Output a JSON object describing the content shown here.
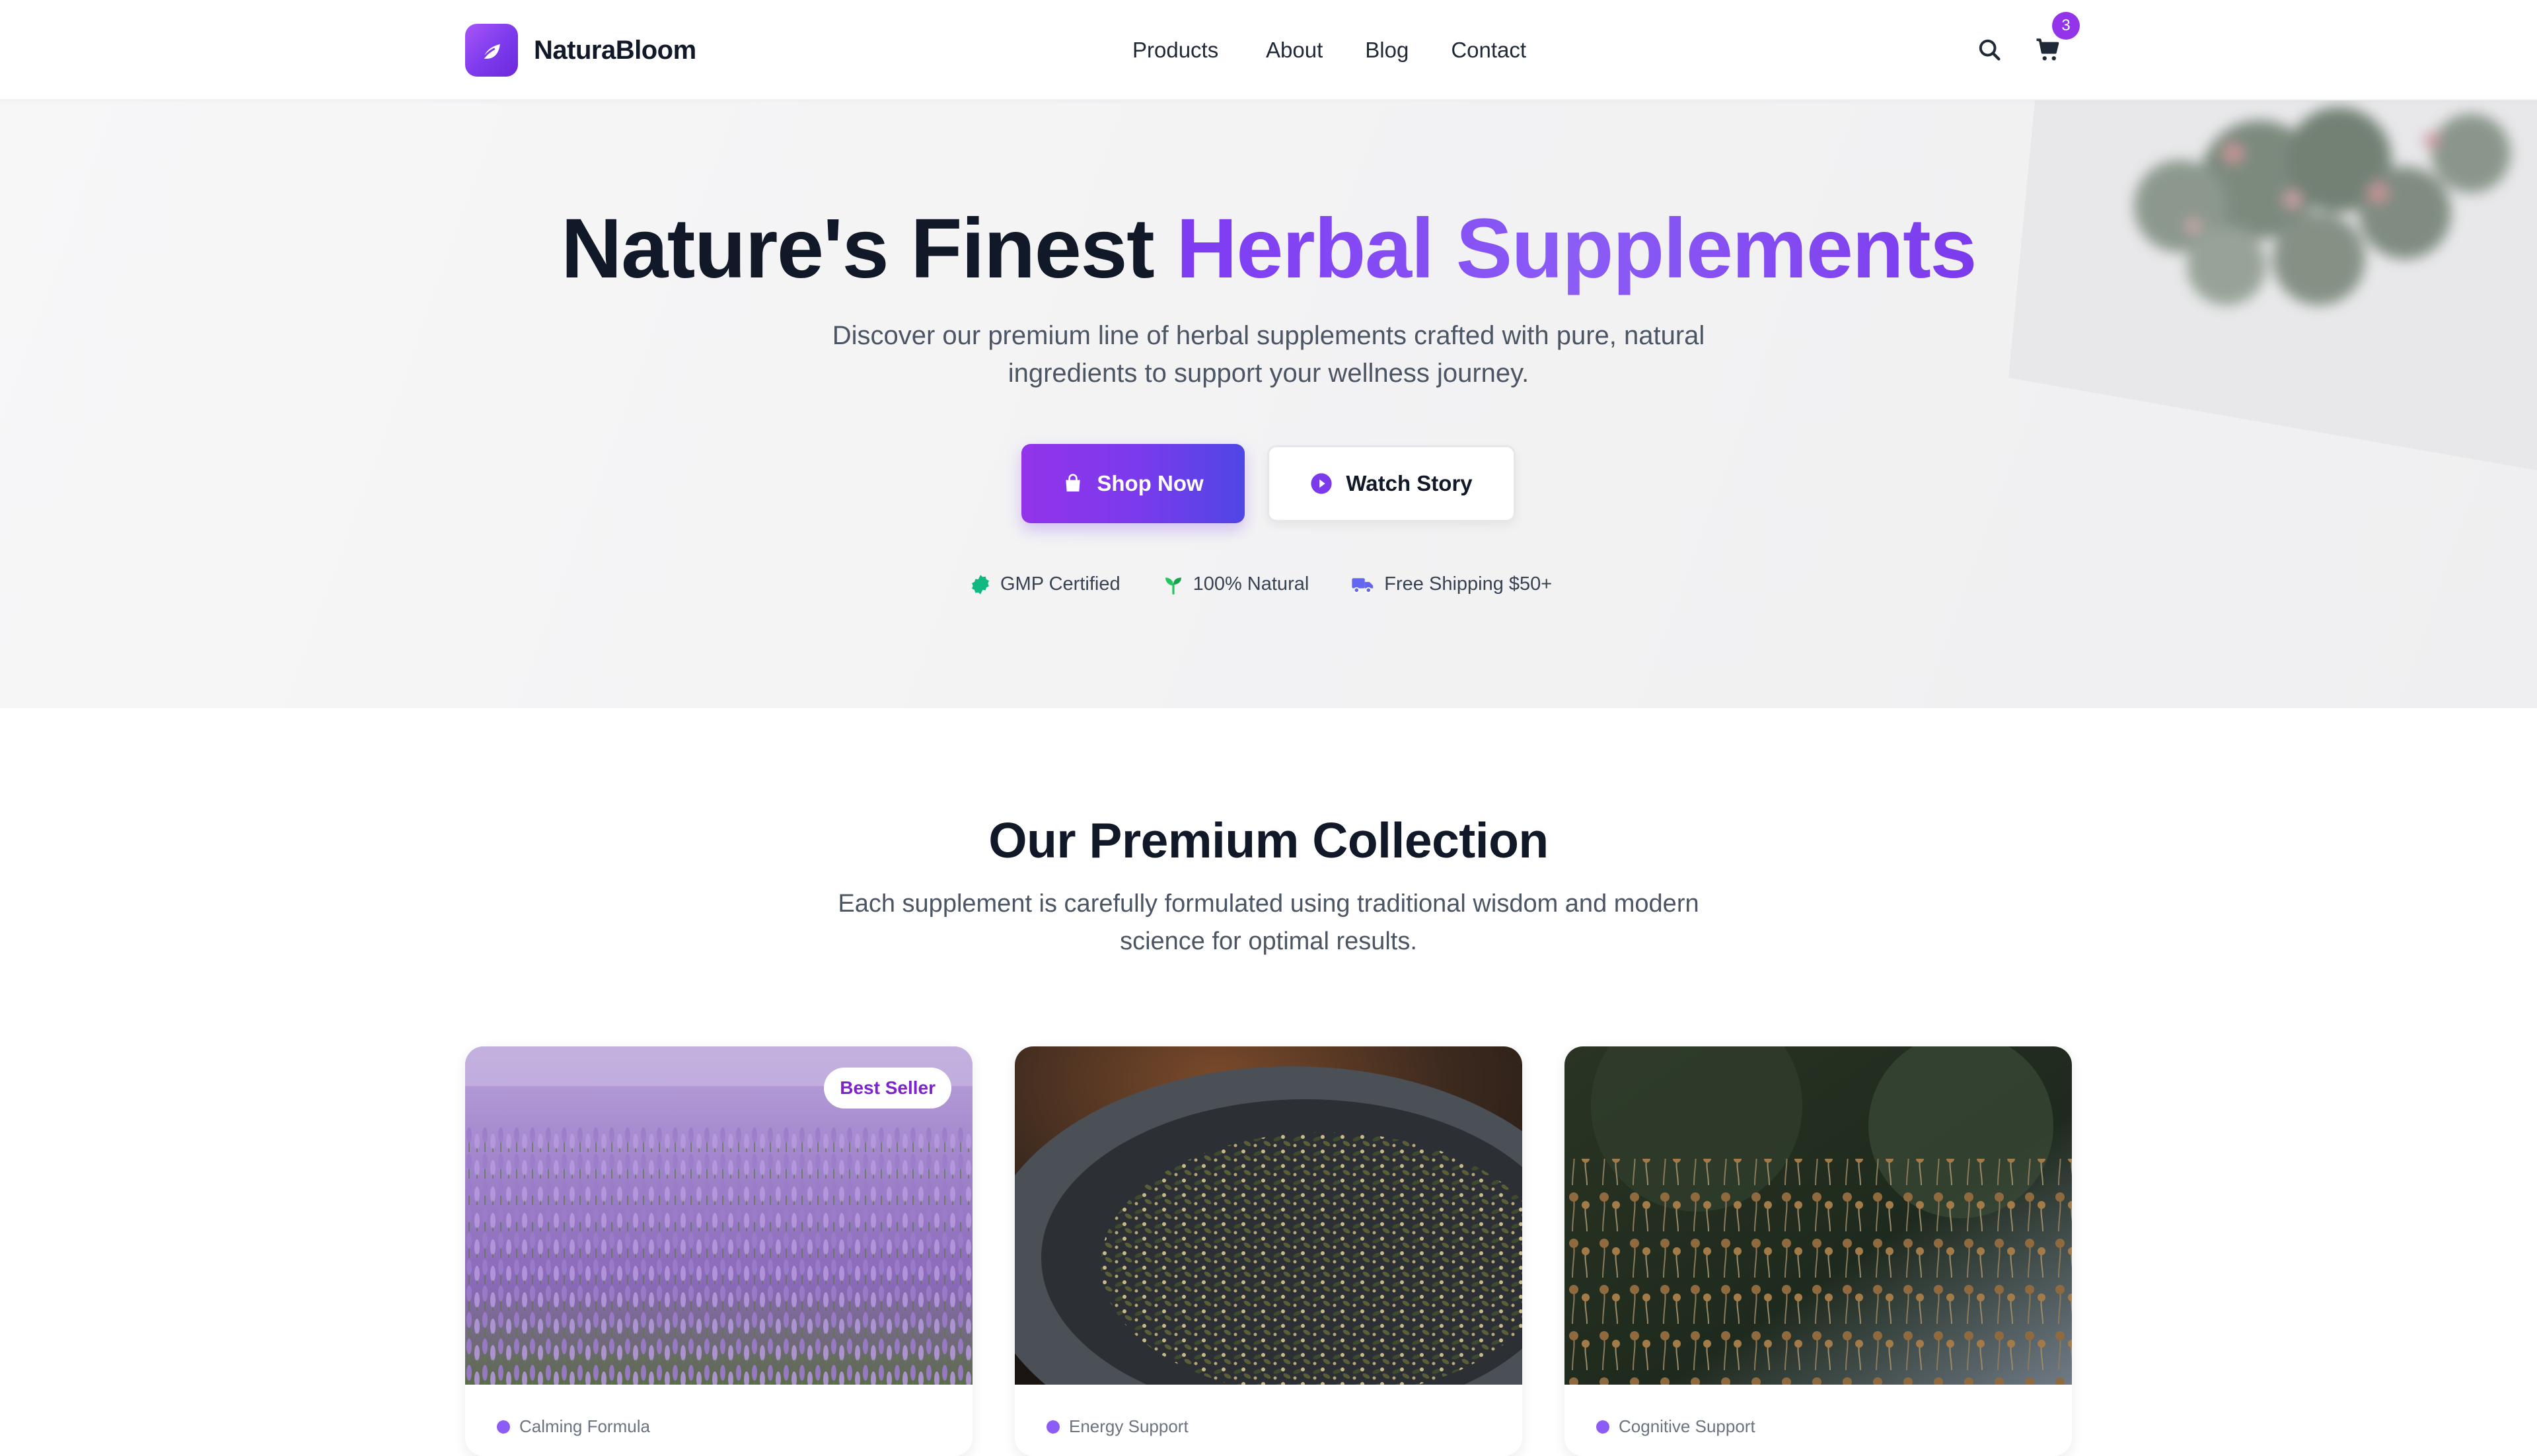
{
  "header": {
    "brand_name": "NaturaBloom",
    "nav": [
      "Products",
      "About",
      "Blog",
      "Contact"
    ],
    "cart_count": "3",
    "icons": {
      "logo": "leaf-icon",
      "search": "search-icon",
      "cart": "cart-icon"
    }
  },
  "hero": {
    "title_main": "Nature's Finest ",
    "title_accent": "Herbal Supplements",
    "subtitle": "Discover our premium line of herbal supplements crafted with pure, natural ingredients to support your wellness journey.",
    "primary_button": "Shop Now",
    "secondary_button": "Watch Story",
    "trust": [
      "GMP Certified",
      "100% Natural",
      "Free Shipping $50+"
    ]
  },
  "collection": {
    "title": "Our Premium Collection",
    "subtitle": "Each supplement is carefully formulated using traditional wisdom and modern science for optimal results.",
    "cards": [
      {
        "badge": "Best Seller",
        "category": "Calming Formula"
      },
      {
        "category": "Energy Support"
      },
      {
        "category": "Cognitive Support"
      }
    ]
  },
  "colors": {
    "accent": "#7c3aed",
    "accent_light": "#a855f7",
    "accent_indigo": "#4f46e5",
    "text": "#111827",
    "muted": "#4b5563",
    "trust_green": "#10b981"
  }
}
